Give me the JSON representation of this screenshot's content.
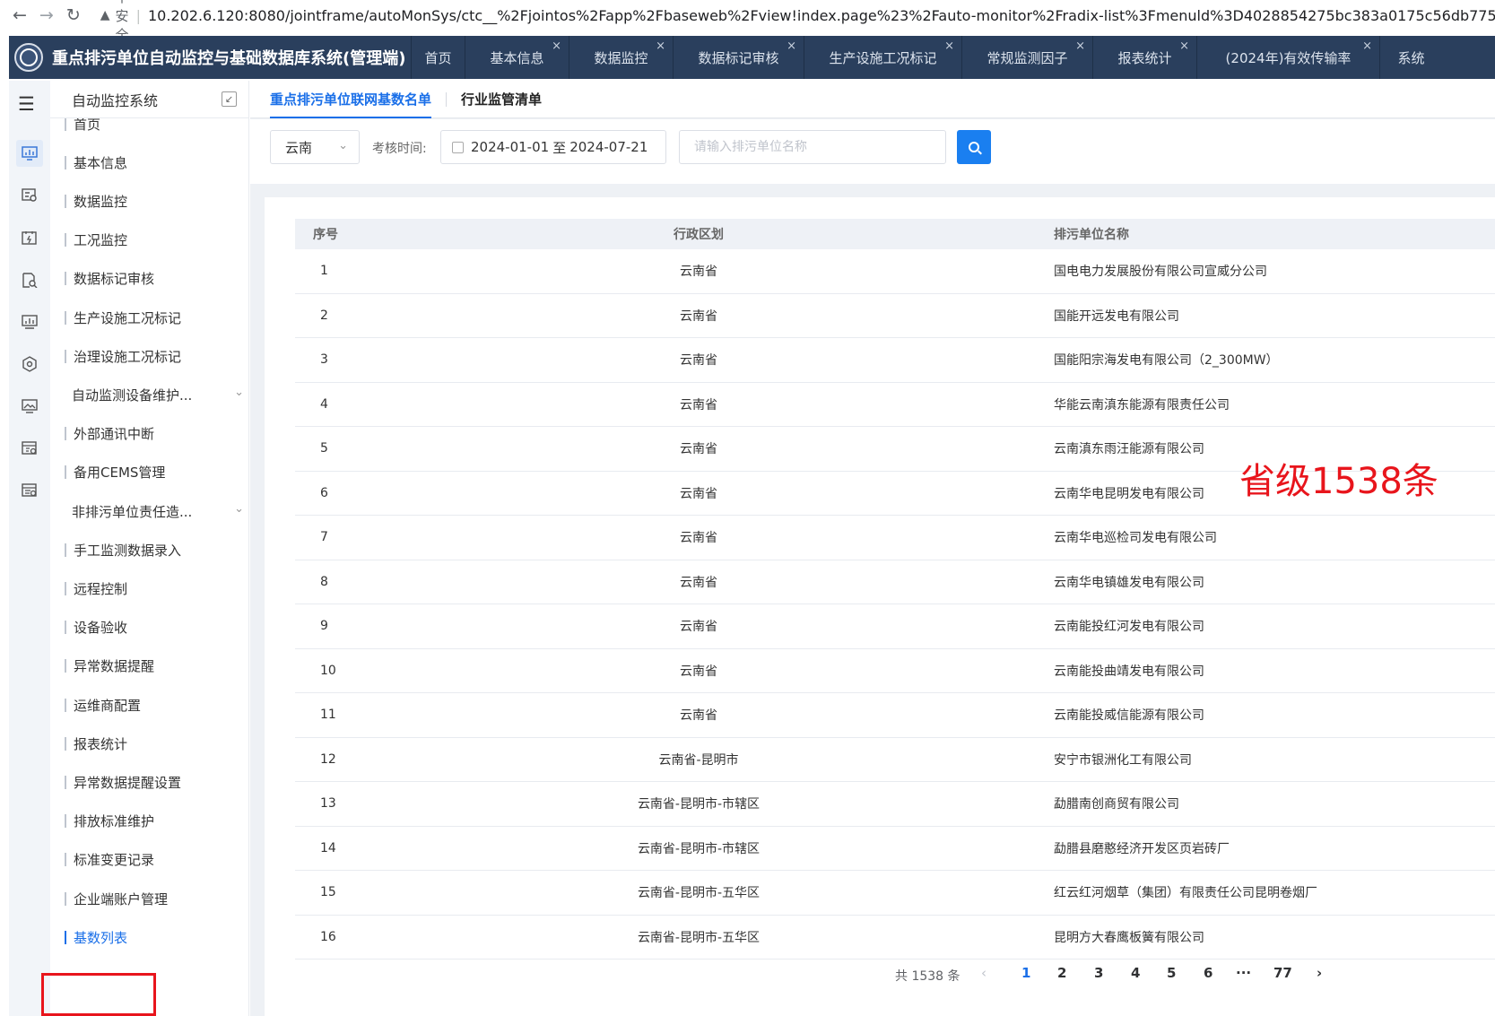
{
  "browser": {
    "back_icon": "←",
    "forward_icon": "→",
    "reload_icon": "↻",
    "warning_icon": "▲",
    "security_label": "不安全",
    "separator": "|",
    "url": "10.202.6.120:8080/jointframe/autoMonSys/ctc__%2Fjointos%2Fapp%2Fbaseweb%2Fview!index.page%23%2Fauto-monitor%2Fradix-list%3Fmenuld%3D4028854275bc383a0175c56db775"
  },
  "header": {
    "title": "重点排污单位自动监控与基础数据库系统(管理端)",
    "close_glyph": "×",
    "tabs": [
      {
        "label": "首页",
        "closable": false
      },
      {
        "label": "基本信息",
        "closable": true
      },
      {
        "label": "数据监控",
        "closable": true
      },
      {
        "label": "数据标记审核",
        "closable": true
      },
      {
        "label": "生产设施工况标记",
        "closable": true
      },
      {
        "label": "常规监测因子",
        "closable": true
      },
      {
        "label": "报表统计",
        "closable": true
      },
      {
        "label": "(2024年)有效传输率",
        "closable": true
      },
      {
        "label": "系统",
        "closable": false
      }
    ]
  },
  "sidebar": {
    "hamburger": "☰",
    "header_label": "自动监控系统",
    "collapse_glyph": "↙",
    "expand_glyph": "⌄",
    "items": [
      {
        "label": "首页",
        "bar": true
      },
      {
        "label": "基本信息",
        "bar": true
      },
      {
        "label": "数据监控",
        "bar": true
      },
      {
        "label": "工况监控",
        "bar": true
      },
      {
        "label": "数据标记审核",
        "bar": true
      },
      {
        "label": "生产设施工况标记",
        "bar": true
      },
      {
        "label": "治理设施工况标记",
        "bar": true
      },
      {
        "label": "自动监测设备维护...",
        "bar": false,
        "expandable": true
      },
      {
        "label": "外部通讯中断",
        "bar": true
      },
      {
        "label": "备用CEMS管理",
        "bar": true
      },
      {
        "label": "非排污单位责任造...",
        "bar": false,
        "expandable": true
      },
      {
        "label": "手工监测数据录入",
        "bar": true
      },
      {
        "label": "远程控制",
        "bar": true
      },
      {
        "label": "设备验收",
        "bar": true
      },
      {
        "label": "异常数据提醒",
        "bar": true
      },
      {
        "label": "运维商配置",
        "bar": true
      },
      {
        "label": "报表统计",
        "bar": true
      },
      {
        "label": "异常数据提醒设置",
        "bar": true
      },
      {
        "label": "排放标准维护",
        "bar": true
      },
      {
        "label": "标准变更记录",
        "bar": true
      },
      {
        "label": "企业端账户管理",
        "bar": true
      },
      {
        "label": "基数列表",
        "bar": true,
        "active": true
      }
    ]
  },
  "subtabs": [
    {
      "label": "重点排污单位联网基数名单",
      "active": true
    },
    {
      "label": "行业监管清单",
      "active": false
    }
  ],
  "filters": {
    "region_value": "云南",
    "caret": "⌄",
    "time_label": "考核时间:",
    "date_start": "2024-01-01",
    "date_sep": "至",
    "date_end": "2024-07-21",
    "name_placeholder": "请输入排污单位名称"
  },
  "table": {
    "headers": [
      "序号",
      "行政区划",
      "排污单位名称"
    ],
    "rows": [
      [
        "1",
        "云南省",
        "国电电力发展股份有限公司宣威分公司"
      ],
      [
        "2",
        "云南省",
        "国能开远发电有限公司"
      ],
      [
        "3",
        "云南省",
        "国能阳宗海发电有限公司（2_300MW）"
      ],
      [
        "4",
        "云南省",
        "华能云南滇东能源有限责任公司"
      ],
      [
        "5",
        "云南省",
        "云南滇东雨汪能源有限公司"
      ],
      [
        "6",
        "云南省",
        "云南华电昆明发电有限公司"
      ],
      [
        "7",
        "云南省",
        "云南华电巡检司发电有限公司"
      ],
      [
        "8",
        "云南省",
        "云南华电镇雄发电有限公司"
      ],
      [
        "9",
        "云南省",
        "云南能投红河发电有限公司"
      ],
      [
        "10",
        "云南省",
        "云南能投曲靖发电有限公司"
      ],
      [
        "11",
        "云南省",
        "云南能投威信能源有限公司"
      ],
      [
        "12",
        "云南省-昆明市",
        "安宁市银洲化工有限公司"
      ],
      [
        "13",
        "云南省-昆明市-市辖区",
        "勐腊南创商贸有限公司"
      ],
      [
        "14",
        "云南省-昆明市-市辖区",
        "勐腊县磨憨经济开发区页岩砖厂"
      ],
      [
        "15",
        "云南省-昆明市-五华区",
        "红云红河烟草（集团）有限责任公司昆明卷烟厂"
      ],
      [
        "16",
        "云南省-昆明市-五华区",
        "昆明方大春鹰板簧有限公司"
      ]
    ]
  },
  "annotation": "省级1538条",
  "pagination": {
    "total_text": "共 1538 条",
    "prev": "‹",
    "pages": [
      "1",
      "2",
      "3",
      "4",
      "5",
      "6"
    ],
    "ellipsis": "···",
    "last": "77",
    "next": "›",
    "current": "1"
  },
  "colors": {
    "header_bg": "#2a3f5d",
    "accent": "#1a6fe8",
    "annotation_red": "#e8151c"
  }
}
